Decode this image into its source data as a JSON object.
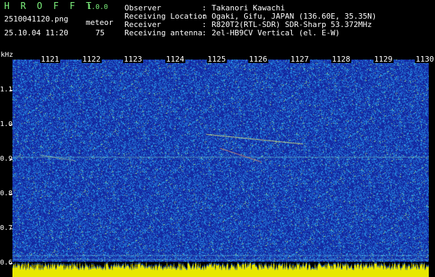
{
  "app": {
    "name": "H R O F F T",
    "version": "1.0.0"
  },
  "capture": {
    "filename": "2510041120.png",
    "datetime": "25.10.04 11:20",
    "detection_label": "meteor",
    "detection_count": "75"
  },
  "meta": [
    {
      "key": "Observer",
      "value": "Takanori Kawachi"
    },
    {
      "key": "Receiving Location",
      "value": "Ogaki, Gifu, JAPAN (136.60E, 35.35N)"
    },
    {
      "key": "Receiver",
      "value": "R820T2(RTL-SDR) SDR-Sharp 53.372MHz"
    },
    {
      "key": "Receiving antenna",
      "value": "2el-HB9CV Vertical (el. E-W)"
    }
  ],
  "colon": ":",
  "yaxis": {
    "unit": "kHz",
    "ticks": [
      "1.1",
      "1.0",
      "0.9",
      "0.8",
      "0.7",
      "0.6"
    ]
  },
  "xaxis": {
    "ticks": [
      "1121",
      "1122",
      "1123",
      "1124",
      "1125",
      "1126",
      "1127",
      "1128",
      "1129",
      "1130"
    ]
  },
  "colors": {
    "background": "#000000",
    "spectrogram_base": "#1f33a8",
    "label_green": "#7cf07c",
    "bottom_strip": "#e8e800"
  }
}
